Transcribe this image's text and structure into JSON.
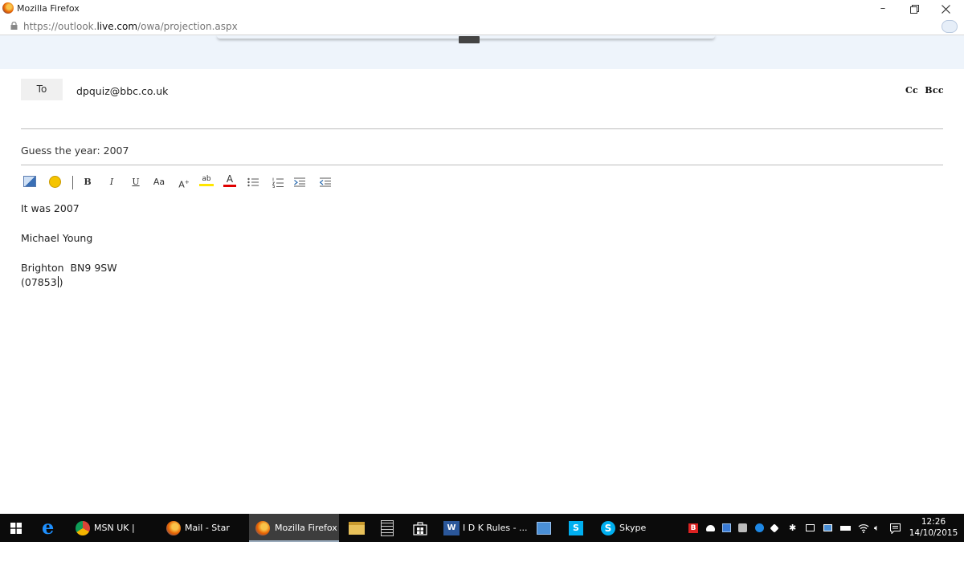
{
  "window": {
    "title": "Mozilla Firefox",
    "url_prefix": "https://outlook.",
    "url_host": "live.com",
    "url_path": "/owa/projection.aspx"
  },
  "compose": {
    "to_label": "To",
    "to_value": "dpquiz@bbc.co.uk",
    "cc_bcc": "Cc  Bcc",
    "subject": "Guess the year: 2007",
    "toolbar": {
      "bold": "B",
      "italic": "I",
      "underline": "U",
      "font_case": "Aa",
      "font_size": "A",
      "highlight": "ab",
      "font_color": "A"
    },
    "body": {
      "line1": "It was 2007",
      "line2": "Michael Young",
      "line3": "Brighton  BN9 9SW",
      "line4": "(07853"
    }
  },
  "taskbar": {
    "items": [
      {
        "label": "MSN UK | Hot..."
      },
      {
        "label": "Mail - Star Ca..."
      },
      {
        "label": "Mozilla Firefox"
      },
      {
        "label": "I D K Rules - ..."
      },
      {
        "label": "Skype"
      }
    ],
    "skype_small": "S",
    "tray_red": "B",
    "time": "12:26",
    "date": "14/10/2015"
  },
  "colors": {
    "header_band": "#eef4fb",
    "taskbar": "#0b0b0b",
    "font_color_underline": "#e00000",
    "highlight_underline": "#ffe600"
  }
}
